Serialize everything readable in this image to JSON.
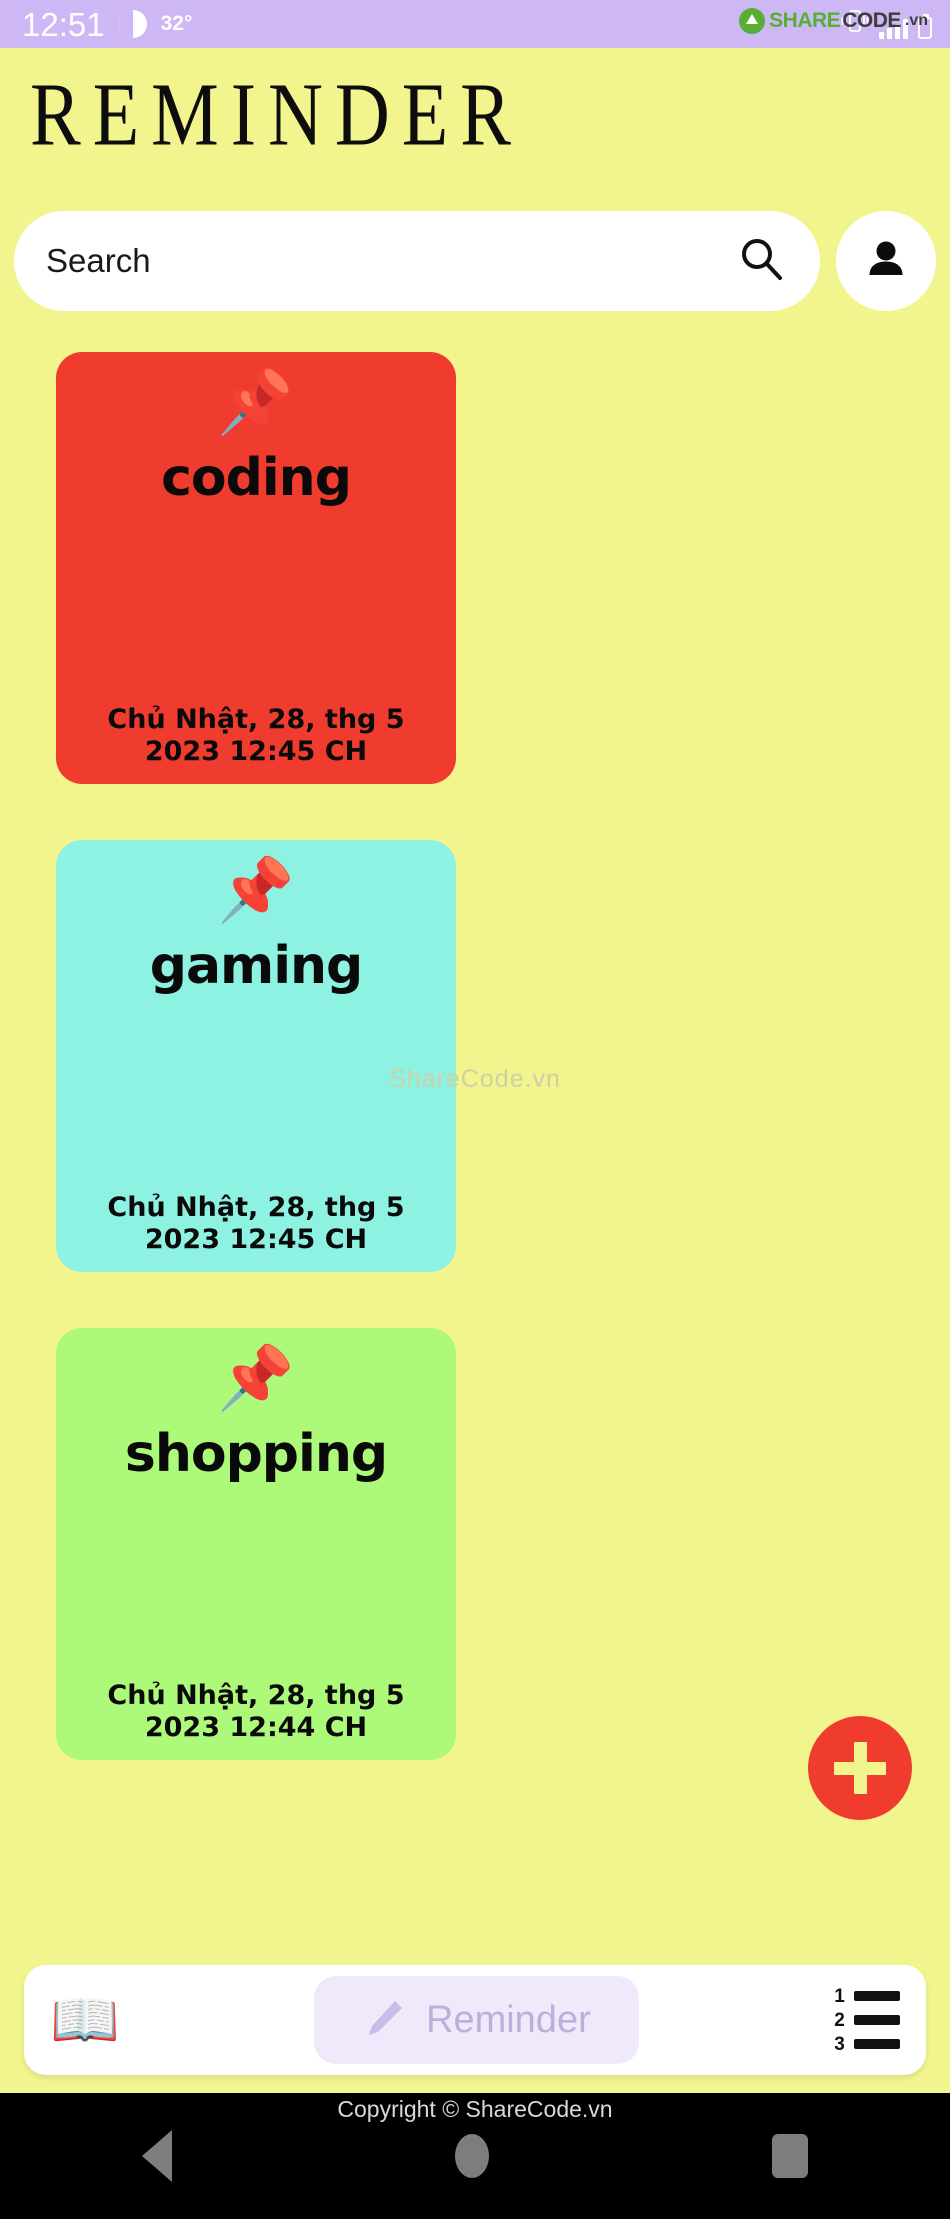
{
  "status_bar": {
    "time": "12:51",
    "temperature": "32°",
    "weather_icon": "weather-circle-icon",
    "vibrate_icon": "vibrate-icon",
    "signal_icon": "signal-bars-icon",
    "battery_icon": "battery-icon",
    "background_color": "#cdb7f5"
  },
  "brand_overlay": {
    "share": "SHARE",
    "code": "CODE",
    "tld": ".vn",
    "green": "#55b033"
  },
  "header": {
    "title": "REMINDER"
  },
  "search": {
    "placeholder": "Search",
    "value": "",
    "icon": "search-icon",
    "avatar_icon": "person-icon"
  },
  "notes": [
    {
      "pin": "📌",
      "title": "coding",
      "date": "Chủ Nhật, 28, thg 5 2023 12:45 CH",
      "color": "#f03c2e"
    },
    {
      "pin": "📌",
      "title": "gaming",
      "date": "Chủ Nhật, 28, thg 5 2023 12:45 CH",
      "color": "#8ef2e2"
    },
    {
      "pin": "📌",
      "title": "shopping",
      "date": "Chủ Nhật, 28, thg 5 2023 12:44 CH",
      "color": "#adf97a"
    }
  ],
  "watermark": "ShareCode.vn",
  "fab": {
    "label": "+",
    "color": "#f03c2e"
  },
  "bottom_nav": {
    "book_icon": "📖",
    "reminder_label": "Reminder",
    "pencil_icon": "pencil-icon",
    "list_icon_numbers": [
      "1",
      "2",
      "3"
    ]
  },
  "android_nav": {
    "back": "back-button",
    "home": "home-button",
    "recents": "recents-button"
  },
  "copyright": "Copyright © ShareCode.vn",
  "page_background": "#f2f58e"
}
